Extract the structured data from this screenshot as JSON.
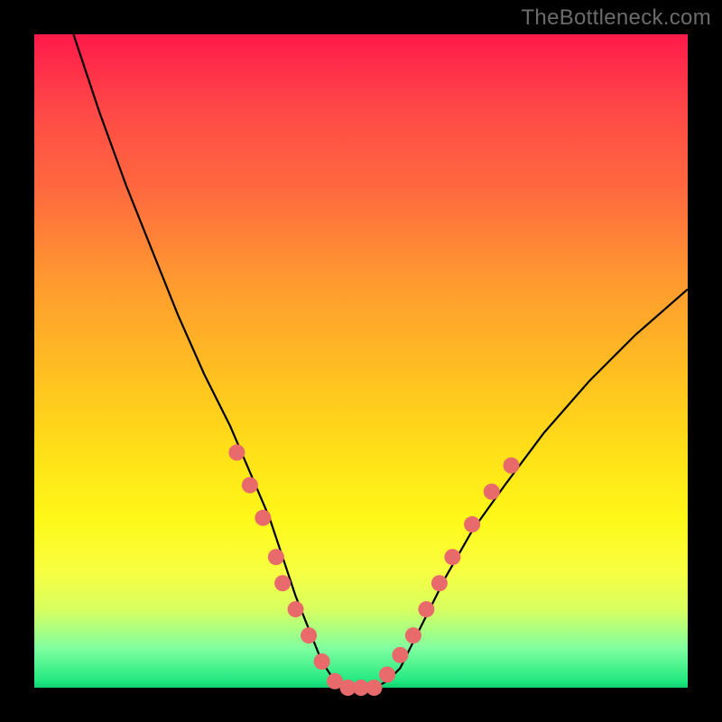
{
  "watermark": "TheBottleneck.com",
  "colors": {
    "gradient_top": "#ff1a4a",
    "gradient_bottom": "#10d070",
    "curve": "#000000",
    "dot": "#e86a6a",
    "frame": "#000000"
  },
  "chart_data": {
    "type": "line",
    "title": "",
    "xlabel": "",
    "ylabel": "",
    "xlim": [
      0,
      100
    ],
    "ylim": [
      0,
      100
    ],
    "series": [
      {
        "name": "curve",
        "x": [
          6,
          10,
          14,
          18,
          22,
          26,
          30,
          33,
          36,
          38,
          40,
          42,
          44,
          46,
          48,
          50,
          52,
          54,
          56,
          58,
          60,
          63,
          67,
          72,
          78,
          85,
          92,
          100
        ],
        "values": [
          100,
          88,
          77,
          67,
          57,
          48,
          40,
          33,
          26,
          20,
          14,
          9,
          4,
          1,
          0,
          0,
          0,
          1,
          3,
          7,
          11,
          17,
          24,
          31,
          39,
          47,
          54,
          61
        ]
      }
    ],
    "points": [
      {
        "name": "left-dot-1",
        "x": 31,
        "y": 36
      },
      {
        "name": "left-dot-2",
        "x": 33,
        "y": 31
      },
      {
        "name": "left-dot-3",
        "x": 35,
        "y": 26
      },
      {
        "name": "left-dot-4",
        "x": 37,
        "y": 20
      },
      {
        "name": "left-dot-5",
        "x": 38,
        "y": 16
      },
      {
        "name": "left-dot-6",
        "x": 40,
        "y": 12
      },
      {
        "name": "left-dot-7",
        "x": 42,
        "y": 8
      },
      {
        "name": "left-dot-8",
        "x": 44,
        "y": 4
      },
      {
        "name": "flat-dot-1",
        "x": 46,
        "y": 1
      },
      {
        "name": "flat-dot-2",
        "x": 48,
        "y": 0
      },
      {
        "name": "flat-dot-3",
        "x": 50,
        "y": 0
      },
      {
        "name": "flat-dot-4",
        "x": 52,
        "y": 0
      },
      {
        "name": "right-dot-1",
        "x": 54,
        "y": 2
      },
      {
        "name": "right-dot-2",
        "x": 56,
        "y": 5
      },
      {
        "name": "right-dot-3",
        "x": 58,
        "y": 8
      },
      {
        "name": "right-dot-4",
        "x": 60,
        "y": 12
      },
      {
        "name": "right-dot-5",
        "x": 62,
        "y": 16
      },
      {
        "name": "right-dot-6",
        "x": 64,
        "y": 20
      },
      {
        "name": "right-dot-7",
        "x": 67,
        "y": 25
      },
      {
        "name": "right-dot-8",
        "x": 70,
        "y": 30
      },
      {
        "name": "right-dot-9",
        "x": 73,
        "y": 34
      }
    ]
  }
}
